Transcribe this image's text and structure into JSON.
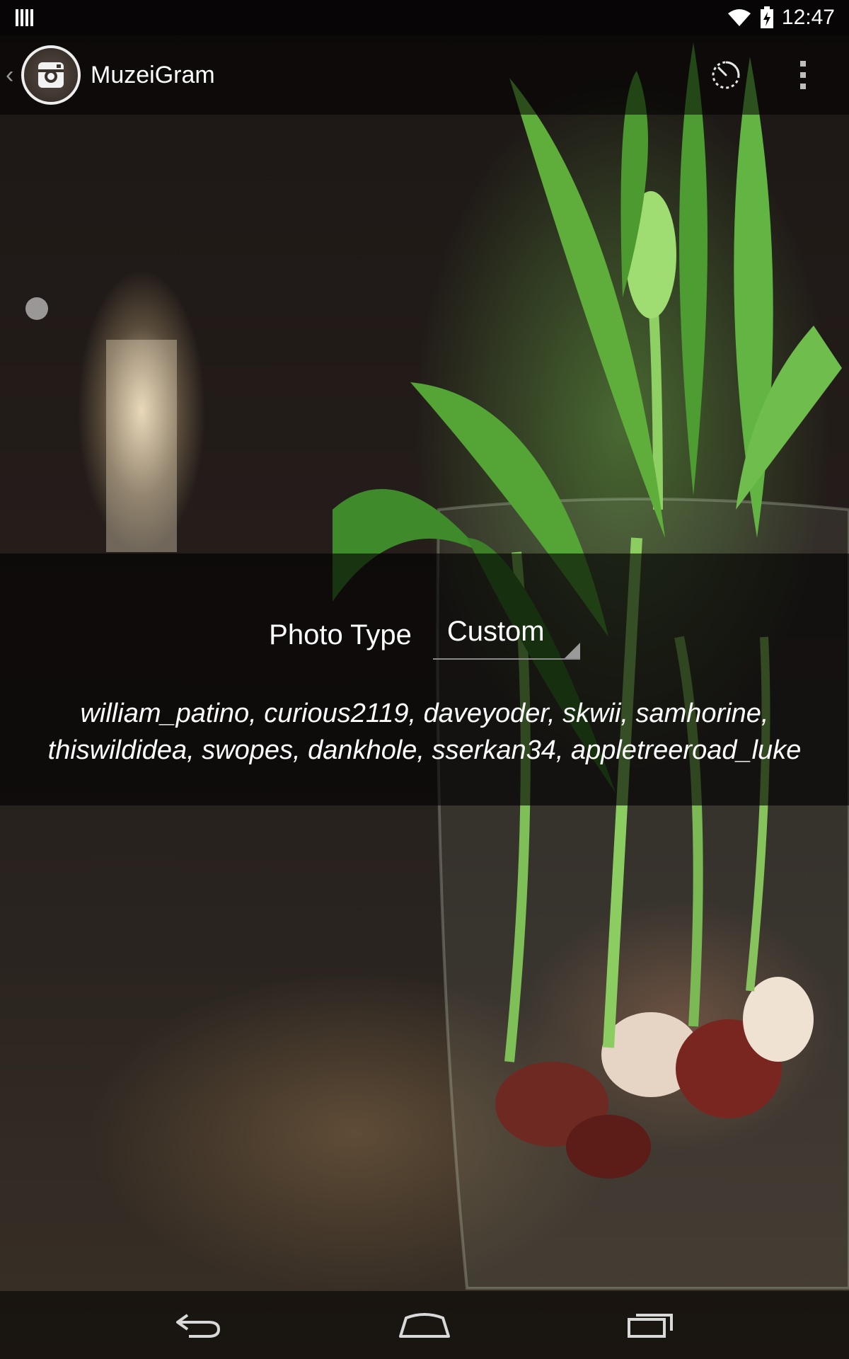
{
  "status_bar": {
    "time": "12:47",
    "icons": [
      "barcode-icon",
      "wifi-icon",
      "battery-charging-icon"
    ]
  },
  "action_bar": {
    "title": "MuzeiGram",
    "icons": [
      "up-chevron-icon",
      "instagram-camera-icon",
      "timer-icon",
      "overflow-menu-icon"
    ]
  },
  "settings": {
    "photo_type_label": "Photo Type",
    "photo_type_value": "Custom",
    "users_line1": "william_patino, curious2119, daveyoder, skwii, samhorine,",
    "users_line2": "thiswildidea, swopes, dankhole, sserkan34, appletreeroad_luke"
  },
  "nav_bar": {
    "icons": [
      "back-icon",
      "home-icon",
      "recents-icon"
    ]
  }
}
